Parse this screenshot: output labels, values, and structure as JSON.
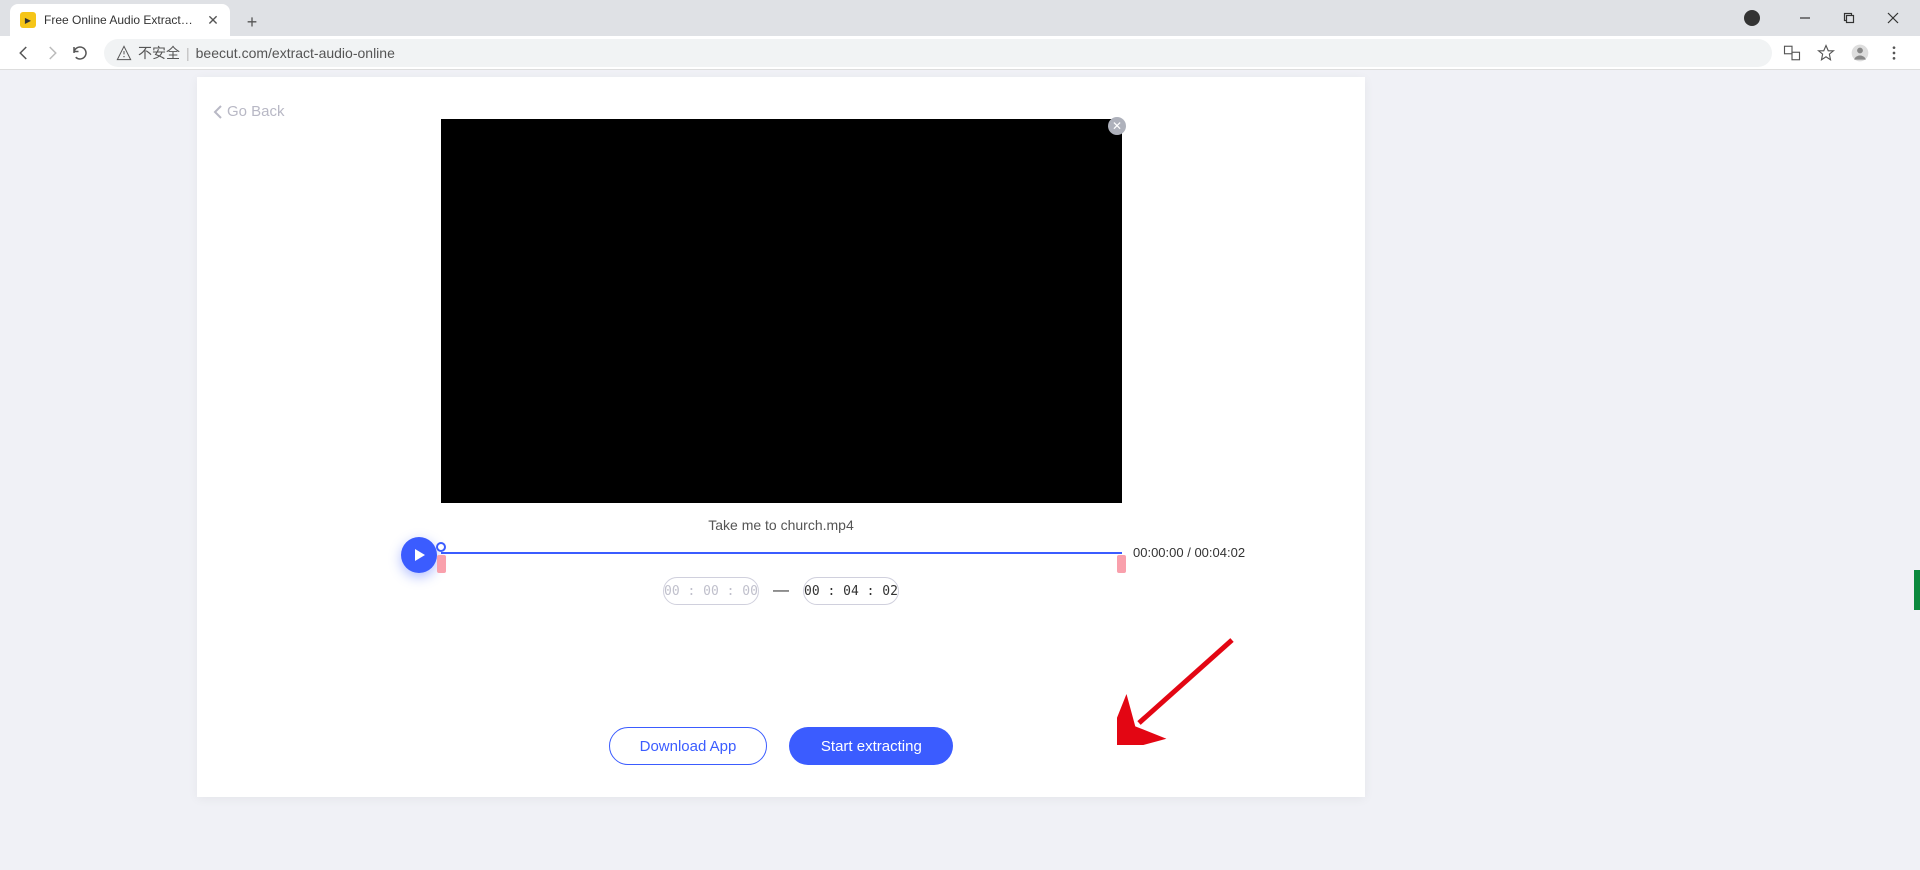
{
  "browser": {
    "tab_title": "Free Online Audio Extractor - l",
    "url_prefix_warning": "不安全",
    "url": "beecut.com/extract-audio-online"
  },
  "page": {
    "go_back": "Go Back",
    "filename": "Take me to church.mp4",
    "time": {
      "current": "00:00:00",
      "total": "00:04:02",
      "start": "00 : 00 : 00",
      "end": "00 : 04 : 02"
    },
    "actions": {
      "download": "Download App",
      "extract": "Start extracting"
    }
  }
}
